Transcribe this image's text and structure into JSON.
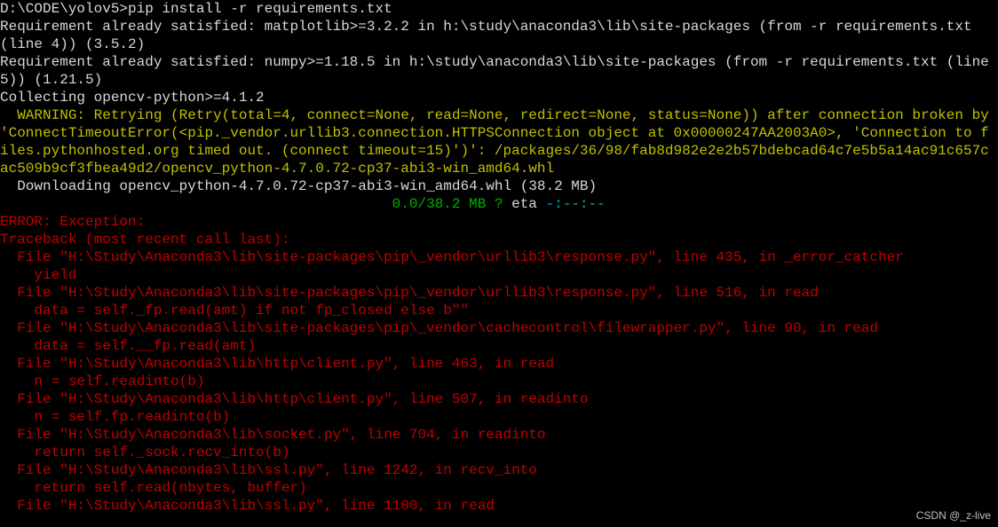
{
  "prompt": "D:\\CODE\\yolov5>pip install -r requirements.txt",
  "req_matplotlib": "Requirement already satisfied: matplotlib>=3.2.2 in h:\\study\\anaconda3\\lib\\site-packages (from -r requirements.txt (line 4)) (3.5.2)",
  "req_numpy": "Requirement already satisfied: numpy>=1.18.5 in h:\\study\\anaconda3\\lib\\site-packages (from -r requirements.txt (line 5)) (1.21.5)",
  "collecting": "Collecting opencv-python>=4.1.2",
  "warning": "  WARNING: Retrying (Retry(total=4, connect=None, read=None, redirect=None, status=None)) after connection broken by 'ConnectTimeoutError(<pip._vendor.urllib3.connection.HTTPSConnection object at 0x00000247AA2003A0>, 'Connection to files.pythonhosted.org timed out. (connect timeout=15)')': /packages/36/98/fab8d982e2e2b57bdebcad64c7e5b5a14ac91c657cac509b9cf3fbea49d2/opencv_python-4.7.0.72-cp37-abi3-win_amd64.whl",
  "downloading": "  Downloading opencv_python-4.7.0.72-cp37-abi3-win_amd64.whl (38.2 MB)",
  "progress_pad": "                                              ",
  "progress_value": "0.0/38.2 MB",
  "progress_speed": " ?",
  "progress_eta_label": " eta ",
  "progress_eta": "-:--:--",
  "error_header": "ERROR: Exception:",
  "traceback_header": "Traceback (most recent call last):",
  "tb": [
    "  File \"H:\\Study\\Anaconda3\\lib\\site-packages\\pip\\_vendor\\urllib3\\response.py\", line 435, in _error_catcher",
    "    yield",
    "  File \"H:\\Study\\Anaconda3\\lib\\site-packages\\pip\\_vendor\\urllib3\\response.py\", line 516, in read",
    "    data = self._fp.read(amt) if not fp_closed else b\"\"",
    "  File \"H:\\Study\\Anaconda3\\lib\\site-packages\\pip\\_vendor\\cachecontrol\\filewrapper.py\", line 90, in read",
    "    data = self.__fp.read(amt)",
    "  File \"H:\\Study\\Anaconda3\\lib\\http\\client.py\", line 463, in read",
    "    n = self.readinto(b)",
    "  File \"H:\\Study\\Anaconda3\\lib\\http\\client.py\", line 507, in readinto",
    "    n = self.fp.readinto(b)",
    "  File \"H:\\Study\\Anaconda3\\lib\\socket.py\", line 704, in readinto",
    "    return self._sock.recv_into(b)",
    "  File \"H:\\Study\\Anaconda3\\lib\\ssl.py\", line 1242, in recv_into",
    "    return self.read(nbytes, buffer)",
    "  File \"H:\\Study\\Anaconda3\\lib\\ssl.py\", line 1100, in read"
  ],
  "watermark": "CSDN @_z-live"
}
